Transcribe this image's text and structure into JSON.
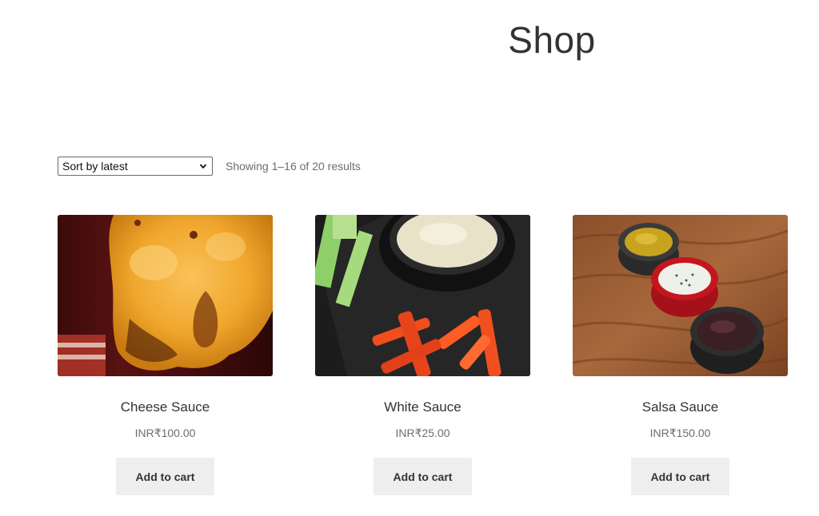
{
  "page": {
    "title": "Shop"
  },
  "toolbar": {
    "sort_selected": "Sort by latest",
    "result_count": "Showing 1–16 of 20 results"
  },
  "products": [
    {
      "name": "Cheese Sauce",
      "price": "INR₹100.00",
      "button_label": "Add to cart",
      "image_desc": "cheese-sauce-photo"
    },
    {
      "name": "White Sauce",
      "price": "INR₹25.00",
      "button_label": "Add to cart",
      "image_desc": "white-sauce-photo"
    },
    {
      "name": "Salsa Sauce",
      "price": "INR₹150.00",
      "button_label": "Add to cart",
      "image_desc": "salsa-sauce-photo"
    }
  ],
  "colors": {
    "button_bg": "#eeeeee",
    "text": "#333333",
    "muted_text": "#6d6d6d"
  }
}
